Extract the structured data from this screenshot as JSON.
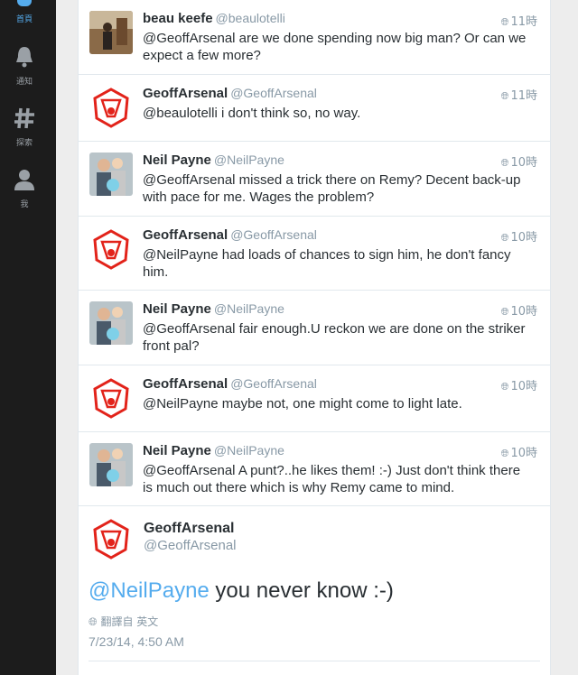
{
  "nav": [
    {
      "id": "home",
      "label": "首頁"
    },
    {
      "id": "notifications",
      "label": "通知"
    },
    {
      "id": "explore",
      "label": "探索"
    },
    {
      "id": "me",
      "label": "我"
    }
  ],
  "tweets": [
    {
      "name": "beau keefe",
      "handle": "@beaulotelli",
      "time": "11時",
      "text": "@GeoffArsenal are we done spending now big man? Or can we expect a few more?",
      "avatar": "photo-man"
    },
    {
      "name": "GeoffArsenal",
      "handle": "@GeoffArsenal",
      "time": "11時",
      "text": "@beaulotelli i don't think so, no way.",
      "avatar": "arsenal-logo"
    },
    {
      "name": "Neil Payne",
      "handle": "@NeilPayne",
      "time": "10時",
      "text": "@GeoffArsenal missed a trick there on Remy? Decent back-up with pace for me. Wages the problem?",
      "avatar": "photo-family"
    },
    {
      "name": "GeoffArsenal",
      "handle": "@GeoffArsenal",
      "time": "10時",
      "text": "@NeilPayne had loads of chances to sign him, he don't fancy him.",
      "avatar": "arsenal-logo"
    },
    {
      "name": "Neil Payne",
      "handle": "@NeilPayne",
      "time": "10時",
      "text": "@GeoffArsenal fair enough.U reckon we are done on the striker front pal?",
      "avatar": "photo-family"
    },
    {
      "name": "GeoffArsenal",
      "handle": "@GeoffArsenal",
      "time": "10時",
      "text": "@NeilPayne maybe not, one might come to light late.",
      "avatar": "arsenal-logo"
    },
    {
      "name": "Neil Payne",
      "handle": "@NeilPayne",
      "time": "10時",
      "text": "@GeoffArsenal A punt?..he likes them! :-) Just don't think there is much out there which is why Remy came to mind.",
      "avatar": "photo-family"
    }
  ],
  "focus": {
    "name": "GeoffArsenal",
    "handle": "@GeoffArsenal",
    "mention": "@NeilPayne",
    "text": " you never know :-)",
    "translated": "翻譯自 英文",
    "timestamp": "7/23/14, 4:50 AM"
  },
  "colors": {
    "accent": "#55acee",
    "sidebar": "#1c1c1c",
    "arsenal_red": "#e2231a"
  }
}
